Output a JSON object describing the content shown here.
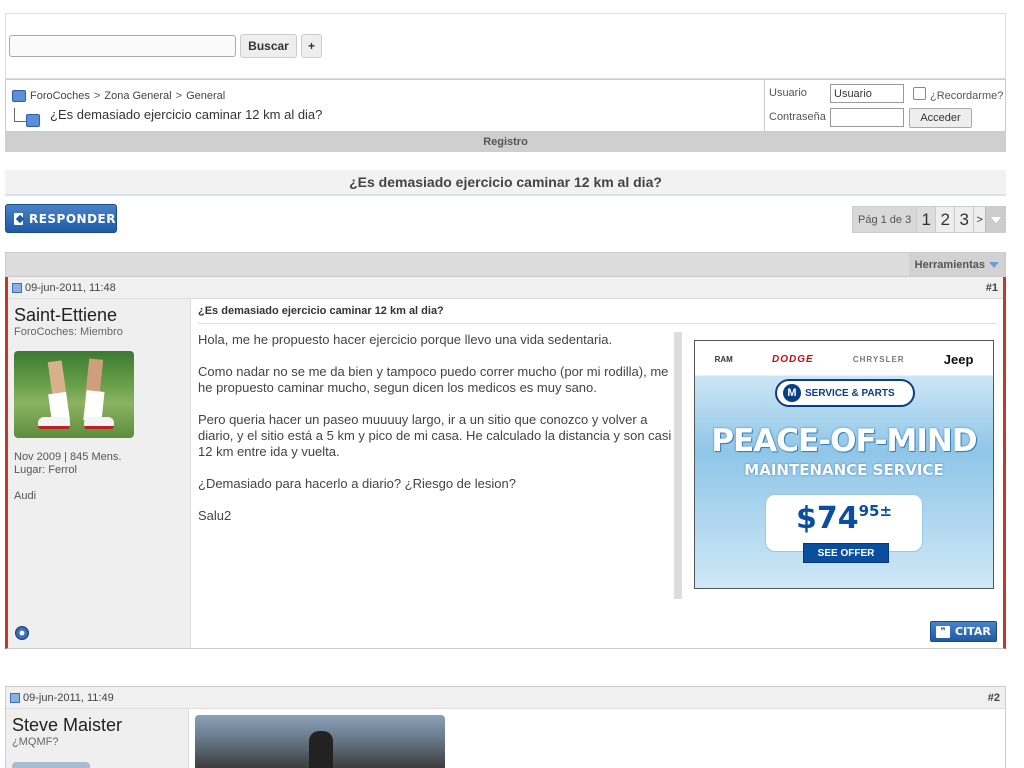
{
  "search": {
    "placeholder": "",
    "button_label": "Buscar",
    "plus_label": "+"
  },
  "breadcrumb": {
    "items": [
      "ForoCoches",
      "Zona General",
      "General"
    ],
    "separator": ">",
    "thread": "¿Es demasiado ejercicio caminar 12 km al dia?"
  },
  "login": {
    "user_label": "Usuario",
    "user_value": "Usuario",
    "pass_label": "Contraseña",
    "remember_label": "¿Recordarme?",
    "submit_label": "Acceder"
  },
  "registro_label": "Registro",
  "thread_title": "¿Es demasiado ejercicio caminar 12 km al dia?",
  "reply_label": "RESPONDER",
  "pager": {
    "label": "Pág 1 de 3",
    "pages": [
      "1",
      "2",
      "3"
    ],
    "next": ">"
  },
  "tools_label": "Herramientas",
  "posts": [
    {
      "date": "09-jun-2011, 11:48",
      "number": "#1",
      "username": "Saint-Ettiene",
      "usertitle": "ForoCoches: Miembro",
      "joined": "Nov 2009 | 845 Mens.",
      "location": "Lugar: Ferrol",
      "car": "Audi",
      "title": "¿Es demasiado ejercicio caminar 12 km al dia?",
      "paragraphs": [
        "Hola, me he propuesto hacer ejercicio porque llevo una vida sedentaria.",
        "Como nadar no se me da bien y tampoco puedo correr mucho (por mi rodilla), me he propuesto caminar mucho, segun dicen los medicos es muy sano.",
        "Pero queria hacer un paseo muuuuy largo, ir a un sitio que conozco y volver a diario, y el sitio está a 5 km y pico de mi casa. He calculado la distancia y son casi 12 km entre ida y vuelta.",
        "¿Demasiado para hacerlo a diario? ¿Riesgo de lesion?",
        "Salu2"
      ],
      "quote_label": "CITAR"
    },
    {
      "date": "09-jun-2011, 11:49",
      "number": "#2",
      "username": "Steve Maister",
      "usertitle": "¿MQMF?"
    }
  ],
  "ad": {
    "brands": [
      "RAM",
      "DODGE",
      "CHRYSLER",
      "Jeep"
    ],
    "badge": "SERVICE & PARTS",
    "headline": "PEACE-OF-MIND",
    "subheadline": "MAINTENANCE SERVICE",
    "price_main": "$74",
    "price_cents": "95",
    "price_suffix": "±",
    "cta": "SEE OFFER"
  },
  "colors": {
    "accent_blue": "#1f5aa5",
    "post_border": "#c0392b",
    "bar_gray": "#cfcfcf"
  }
}
